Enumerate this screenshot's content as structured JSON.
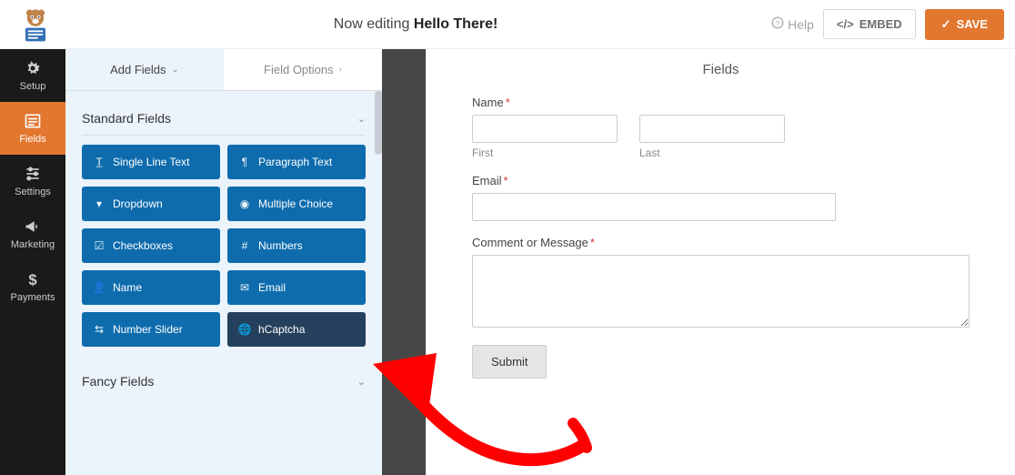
{
  "topbar": {
    "editing_prefix": "Now editing ",
    "form_name": "Hello There!",
    "help": "Help",
    "embed": "EMBED",
    "save": "SAVE"
  },
  "nav": {
    "setup": "Setup",
    "fields": "Fields",
    "settings": "Settings",
    "marketing": "Marketing",
    "payments": "Payments"
  },
  "panel": {
    "tab_add": "Add Fields",
    "tab_options": "Field Options",
    "group_standard": "Standard Fields",
    "group_fancy": "Fancy Fields",
    "fields": {
      "single_line": "Single Line Text",
      "paragraph": "Paragraph Text",
      "dropdown": "Dropdown",
      "multiple_choice": "Multiple Choice",
      "checkboxes": "Checkboxes",
      "numbers": "Numbers",
      "name": "Name",
      "email": "Email",
      "number_slider": "Number Slider",
      "hcaptcha": "hCaptcha"
    }
  },
  "preview": {
    "title": "Fields",
    "name_label": "Name",
    "first": "First",
    "last": "Last",
    "email_label": "Email",
    "comment_label": "Comment or Message",
    "submit": "Submit"
  }
}
